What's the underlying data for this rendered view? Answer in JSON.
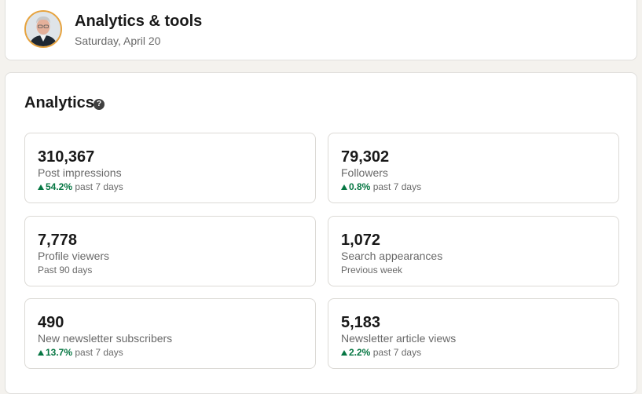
{
  "header": {
    "title": "Analytics & tools",
    "date": "Saturday, April 20",
    "avatar_icon": "profile-photo"
  },
  "analytics": {
    "title": "Analytics",
    "help_icon": "question-circle-icon",
    "tiles": [
      {
        "value": "310,367",
        "label": "Post impressions",
        "trend": "54.2%",
        "period": "past 7 days"
      },
      {
        "value": "79,302",
        "label": "Followers",
        "trend": "0.8%",
        "period": "past 7 days"
      },
      {
        "value": "7,778",
        "label": "Profile viewers",
        "period": "Past 90 days"
      },
      {
        "value": "1,072",
        "label": "Search appearances",
        "period": "Previous week"
      },
      {
        "value": "490",
        "label": "New newsletter subscribers",
        "trend": "13.7%",
        "period": "past 7 days"
      },
      {
        "value": "5,183",
        "label": "Newsletter article views",
        "trend": "2.2%",
        "period": "past 7 days"
      }
    ]
  },
  "colors": {
    "trend_up": "#057642",
    "avatar_ring": "#e7a33e",
    "background": "#f4f2ee"
  }
}
